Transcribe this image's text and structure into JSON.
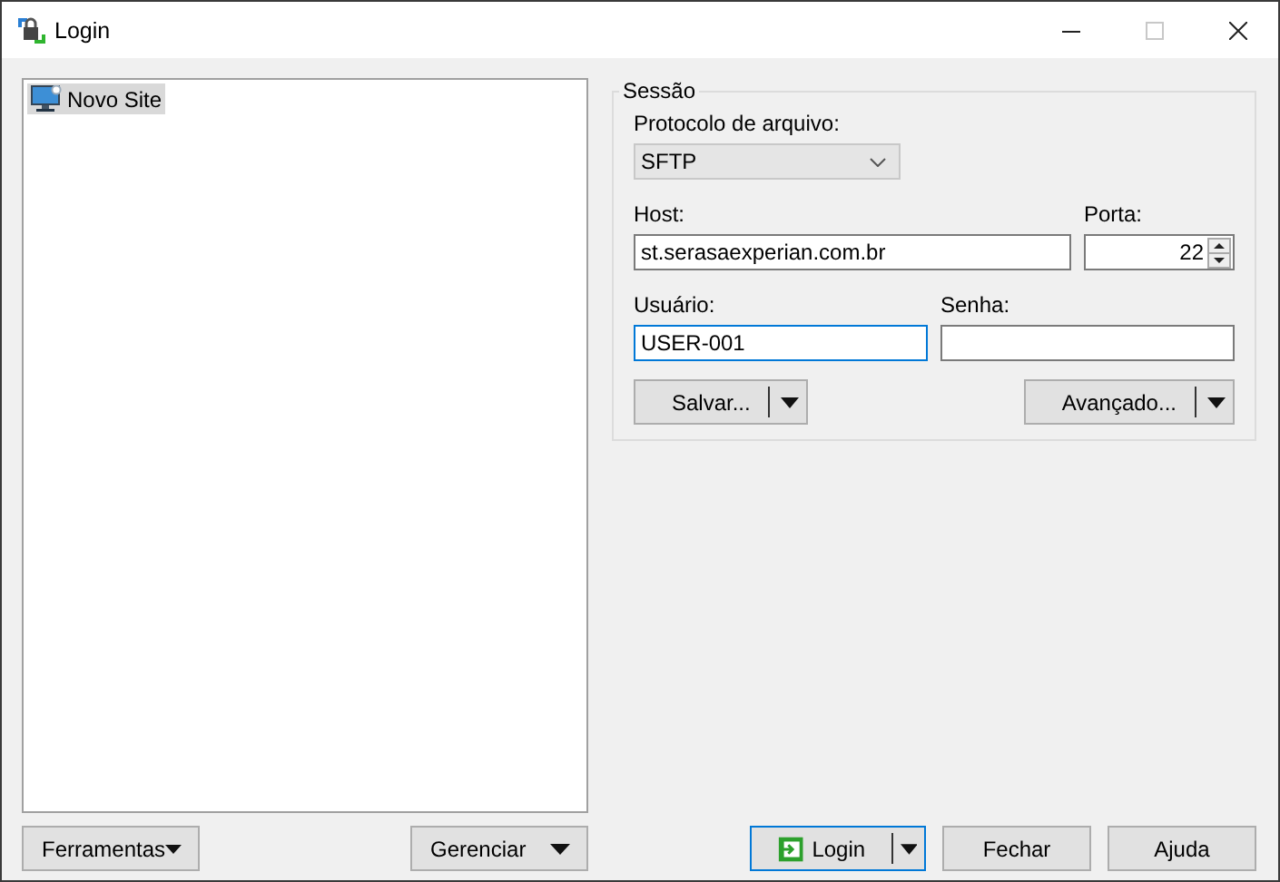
{
  "window": {
    "title": "Login",
    "maximize_disabled": true
  },
  "sites": [
    {
      "label": "Novo Site",
      "selected": true
    }
  ],
  "left_buttons": [
    {
      "label": "Ferramentas",
      "kind": "menu"
    },
    {
      "label": "Gerenciar",
      "kind": "menu"
    }
  ],
  "session": {
    "title": "Sessão",
    "protocol": {
      "label": "Protocolo de arquivo:",
      "value": "SFTP"
    },
    "host": {
      "label": "Host:",
      "value": "st.serasaexperian.com.br",
      "focused": false
    },
    "port": {
      "label": "Porta:",
      "value": "22",
      "focused": false
    },
    "user": {
      "label": "Usuário:",
      "value": "USER-001",
      "focused": true
    },
    "password": {
      "label": "Senha:",
      "focused": false
    },
    "buttons": [
      {
        "label": "Salvar..."
      },
      {
        "label": "Avançado..."
      }
    ]
  },
  "footer_buttons": [
    {
      "label": "Login",
      "kind": "split",
      "default": true
    },
    {
      "label": "Fechar",
      "kind": "plain",
      "default": false
    },
    {
      "label": "Ajuda",
      "kind": "plain",
      "default": false
    }
  ]
}
